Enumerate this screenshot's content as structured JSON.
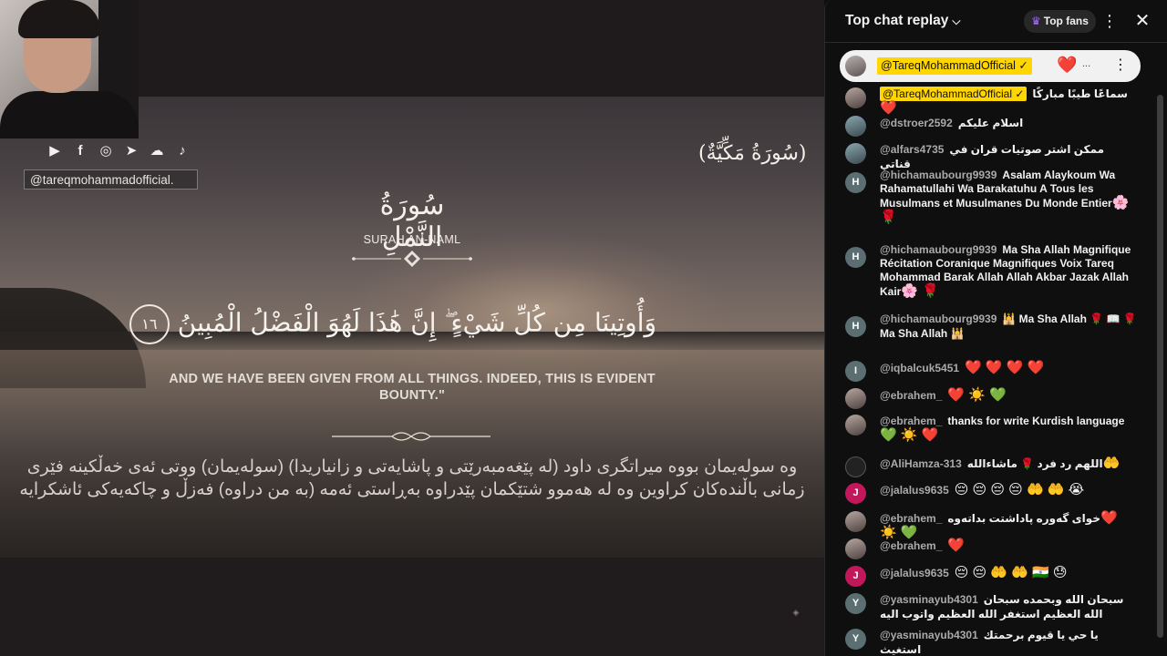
{
  "video": {
    "social_icons": [
      "youtube-icon",
      "facebook-icon",
      "instagram-icon",
      "telegram-icon",
      "soundcloud-icon",
      "tiktok-icon"
    ],
    "social_glyphs": [
      "▶",
      "f",
      "◎",
      "➤",
      "☁",
      "♪"
    ],
    "handle": "@tareqmohammadofficial.",
    "surah_tag": "(سُورَةُ مَكِّيَّةٌ)",
    "surah_name_ar": "سُورَةُ النَّمْلِ",
    "surah_name_en": "SURAH AN-NAML",
    "verse_ar": "وَأُوتِينَا مِن كُلِّ شَيْءٍ ۖ إِنَّ هَٰذَا لَهُوَ الْفَضْلُ الْمُبِينُ",
    "verse_number": "١٦",
    "verse_en": "AND WE HAVE BEEN GIVEN FROM ALL THINGS. INDEED, THIS IS EVIDENT BOUNTY.\"",
    "translation_ku": "وە سولەیمان بووە میراتگری داود (لە پێغەمبەرێتی و پاشایەتی و زانیاریدا) (سولەیمان) ووتی ئەی خەڵکینە فێری زمانی باڵندەکان کراوین وە لە هەموو شتێکمان پێدراوە بەڕاستی ئەمە (بە من دراوە) فەزڵ و چاکەیەکی ئاشکرایە"
  },
  "chat": {
    "title": "Top chat replay",
    "top_fans_label": "Top fans",
    "pinned": {
      "author": "@TareqMohammadOfficial ✓",
      "text": "..."
    },
    "messages": [
      {
        "author": "@TareqMohammadOfficial ✓",
        "owner": true,
        "text": "سماعًا طيبًا مباركًا",
        "emoji": "❤️",
        "avatar": "photo"
      },
      {
        "author": "@dstroer2592",
        "text": "اسلام عليكم",
        "emoji": "",
        "avatar": "photo2"
      },
      {
        "author": "@alfars4735",
        "text": "ممكن اشتر صوتيات قران في قناتي",
        "emoji": "",
        "avatar": "photo2"
      },
      {
        "author": "@hichamaubourg9939",
        "text": "Asalam Alaykoum Wa Rahamatullahi Wa Barakatuhu A Tous les Musulmans et Musulmanes Du Monde Entier",
        "emoji": "🌸 🌹",
        "avatar": "H"
      },
      {
        "author": "@hichamaubourg9939",
        "text": "Ma Sha Allah Magnifique Récitation Coranique Magnifiques Voix Tareq Mohammad Barak Allah Allah Akbar Jazak Allah Kair",
        "emoji": "🌸 🌹",
        "avatar": "H"
      },
      {
        "author": "@hichamaubourg9939",
        "text": "🕌 Ma Sha Allah 🌹 📖 🌹 Ma Sha Allah 🕌",
        "emoji": "",
        "avatar": "H"
      },
      {
        "author": "@iqbalcuk5451",
        "text": "",
        "emoji": "❤️ ❤️ ❤️ ❤️",
        "avatar": "I"
      },
      {
        "author": "@ebrahem_",
        "text": "",
        "emoji": "❤️ ☀️ 💚",
        "avatar": "photo"
      },
      {
        "author": "@ebrahem_",
        "text": "thanks for write Kurdish language",
        "emoji": "💚 ☀️ ❤️",
        "avatar": "photo"
      },
      {
        "author": "@AliHamza-313",
        "text": "اللهم رد فرد 🌹 ماشاءالله",
        "emoji": "🤲",
        "avatar": "dark"
      },
      {
        "author": "@jalalus9635",
        "text": "",
        "emoji": "😔 😔 😔 😔 🤲 🤲 😭",
        "avatar": "J"
      },
      {
        "author": "@ebrahem_",
        "text": "خوای گەورە پاداشتت بداتەوە",
        "emoji": "❤️ ☀️ 💚",
        "avatar": "photo"
      },
      {
        "author": "@ebrahem_",
        "text": "",
        "emoji": "❤️",
        "avatar": "photo"
      },
      {
        "author": "@jalalus9635",
        "text": "",
        "emoji": "😔 😔 🤲 🤲 🇮🇳 😓",
        "avatar": "J"
      },
      {
        "author": "@yasminayub4301",
        "text": "سبحان الله وبحمده سبحان الله العظيم استغفر الله العظيم واتوب اليه",
        "emoji": "",
        "avatar": "Y"
      },
      {
        "author": "@yasminayub4301",
        "text": "يا حي يا قيوم برحمتك استغيث",
        "emoji": "",
        "avatar": "Y"
      }
    ]
  }
}
